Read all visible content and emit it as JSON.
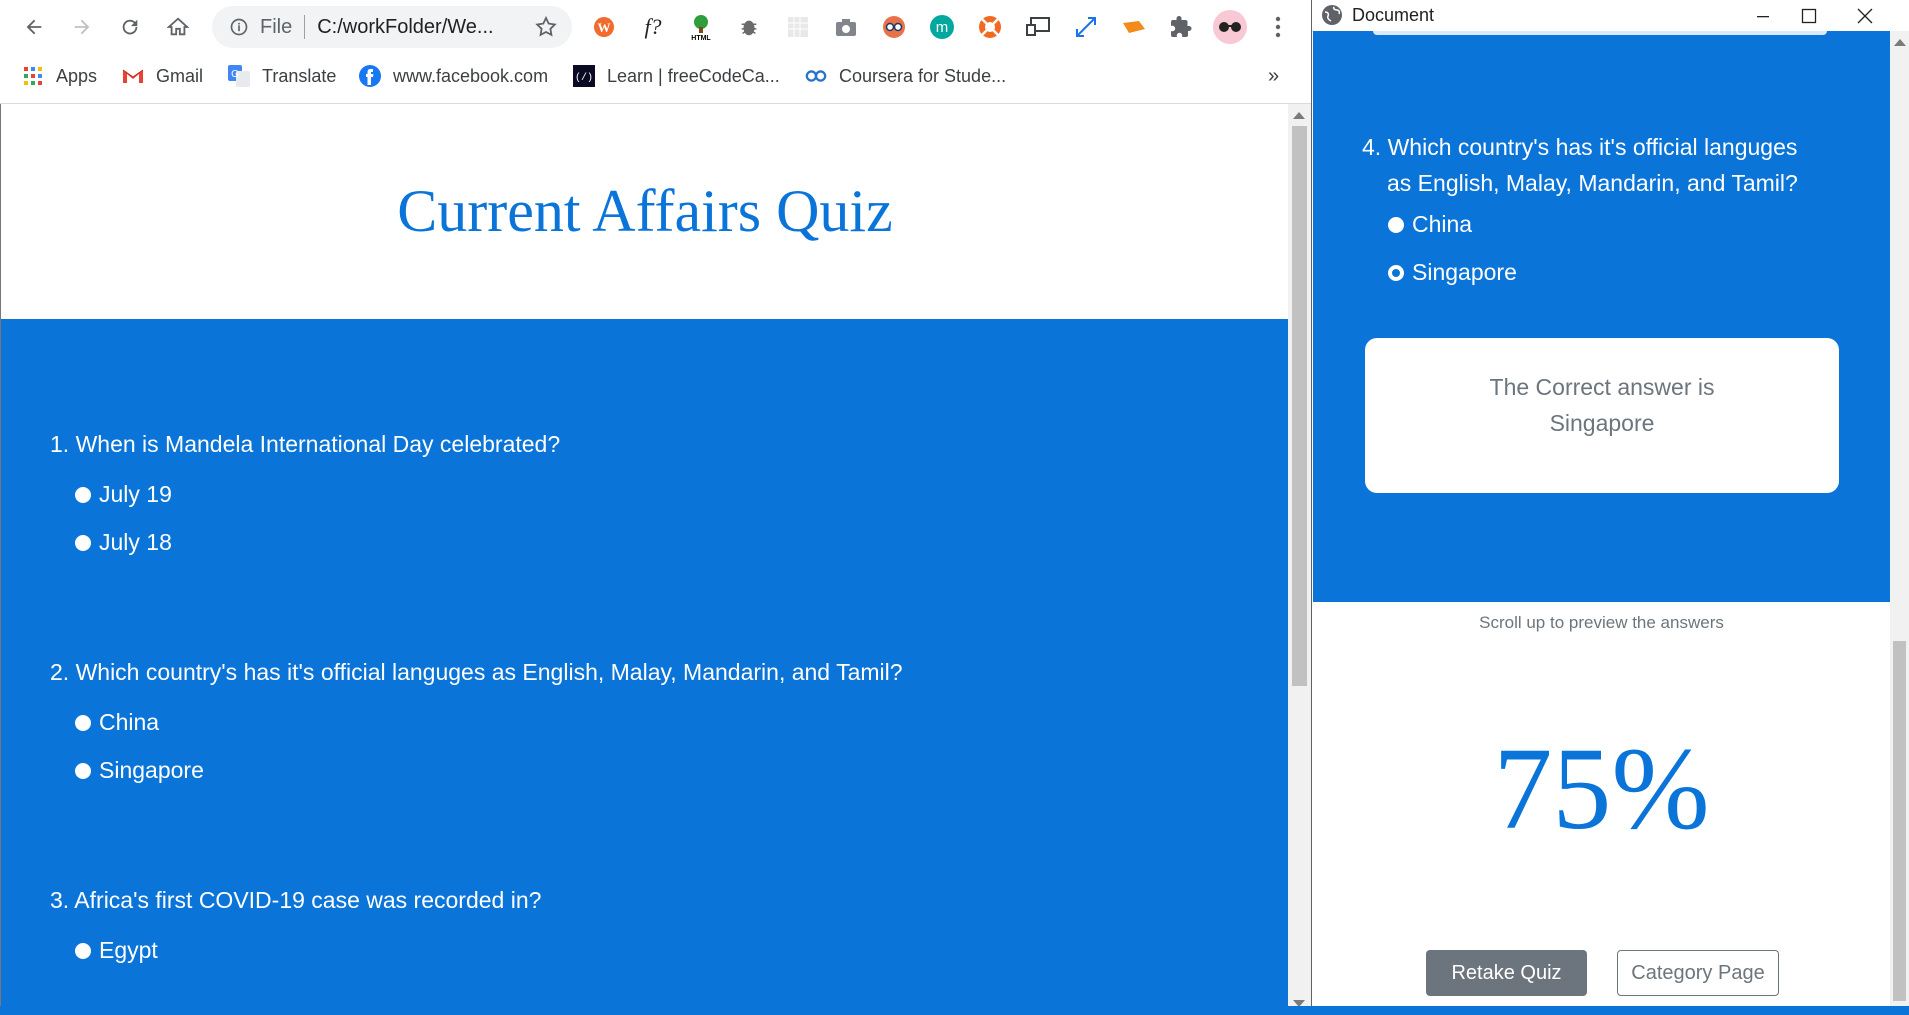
{
  "browser": {
    "omnibox": {
      "scheme_label": "File",
      "url": "C:/workFolder/We..."
    },
    "bookmarks": [
      {
        "label": "Apps"
      },
      {
        "label": "Gmail"
      },
      {
        "label": "Translate"
      },
      {
        "label": "www.facebook.com"
      },
      {
        "label": "Learn | freeCodeCa..."
      },
      {
        "label": "Coursera for Stude..."
      }
    ],
    "bookmarks_overflow": "»",
    "extensions": [
      {
        "name": "wordpress-icon",
        "glyph": "W"
      },
      {
        "name": "function-icon",
        "glyph": "f?"
      },
      {
        "name": "html-tree-icon",
        "glyph": "HTML"
      },
      {
        "name": "bug-icon",
        "glyph": ""
      },
      {
        "name": "grid-icon",
        "glyph": ""
      },
      {
        "name": "camera-icon",
        "glyph": ""
      },
      {
        "name": "spy-icon",
        "glyph": ""
      },
      {
        "name": "m-icon",
        "glyph": "m"
      },
      {
        "name": "lifebuoy-icon",
        "glyph": ""
      },
      {
        "name": "screen-icon",
        "glyph": ""
      },
      {
        "name": "expand-icon",
        "glyph": ""
      },
      {
        "name": "tag-icon",
        "glyph": ""
      },
      {
        "name": "puzzle-icon",
        "glyph": ""
      }
    ]
  },
  "quiz": {
    "title": "Current Affairs Quiz",
    "questions": [
      {
        "text": "1. When is Mandela International Day celebrated?",
        "options": [
          "July 19",
          "July 18"
        ]
      },
      {
        "text": "2. Which country's has it's official languges as English, Malay, Mandarin, and Tamil?",
        "options": [
          "China",
          "Singapore"
        ]
      },
      {
        "text": "3. Africa's first COVID-19 case was recorded in?",
        "options": [
          "Egypt"
        ]
      }
    ]
  },
  "popup": {
    "title": "Document",
    "question": {
      "number": "4.",
      "line1": "Which country's has it's official languges",
      "line2": "as English, Malay, Mandarin, and Tamil?",
      "options": [
        "China",
        "Singapore"
      ]
    },
    "answer": {
      "line1": "The Correct answer is",
      "line2": "Singapore"
    },
    "scroll_hint": "Scroll up to preview the answers",
    "score": "75%",
    "retake_label": "Retake Quiz",
    "category_label": "Category Page"
  },
  "colors": {
    "accent": "#0a74d9",
    "secondary": "#6c757d"
  }
}
